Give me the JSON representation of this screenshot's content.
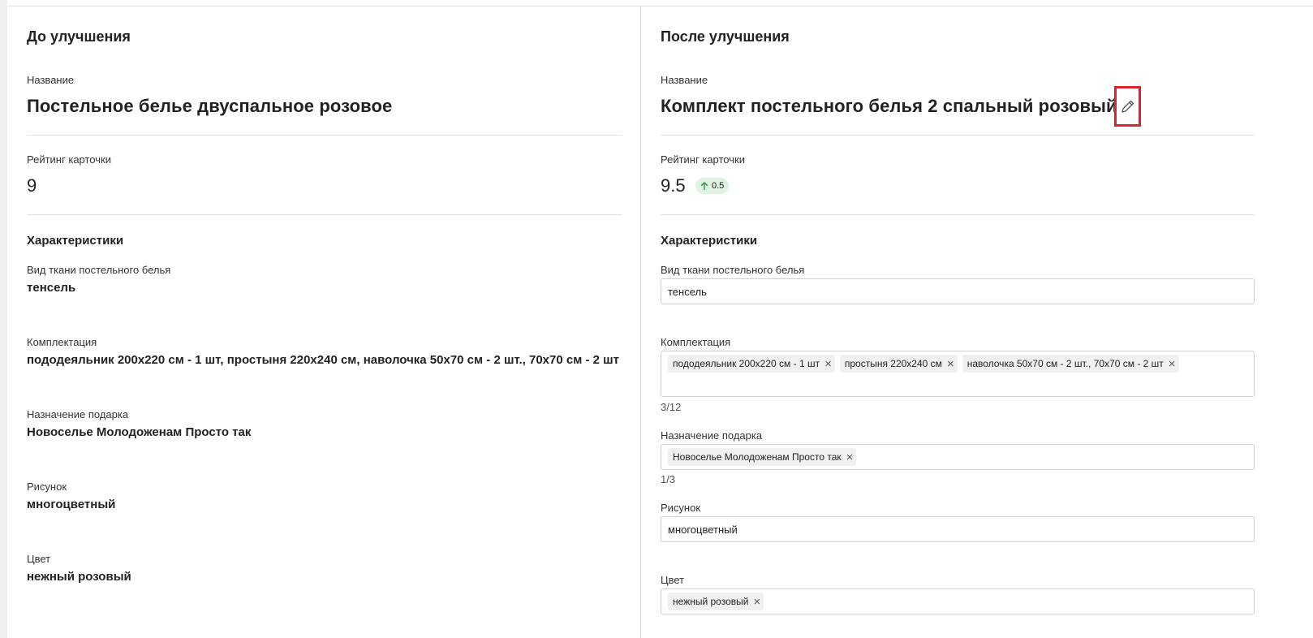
{
  "before": {
    "heading": "До улучшения",
    "name_label": "Название",
    "name_value": "Постельное белье двуспальное розовое",
    "rating_label": "Рейтинг карточки",
    "rating_value": "9",
    "specs_heading": "Характеристики",
    "fabric_label": "Вид ткани постельного белья",
    "fabric_value": "тенсель",
    "kit_label": "Комплектация",
    "kit_value": "пододеяльник 200х220 см - 1 шт, простыня 220х240 см, наволочка 50х70 см - 2 шт., 70х70 см - 2 шт",
    "gift_label": "Назначение подарка",
    "gift_value": "Новоселье Молодоженам Просто так",
    "pattern_label": "Рисунок",
    "pattern_value": "многоцветный",
    "color_label": "Цвет",
    "color_value": "нежный розовый"
  },
  "after": {
    "heading": "После улучшения",
    "name_label": "Название",
    "name_value": "Комплект постельного белья 2 спальный розовый",
    "edit_icon": "pencil-icon",
    "rating_label": "Рейтинг карточки",
    "rating_value": "9.5",
    "rating_delta": "0.5",
    "rating_delta_icon": "arrow-up-icon",
    "specs_heading": "Характеристики",
    "fabric_label": "Вид ткани постельного белья",
    "fabric_value": "тенсель",
    "kit_label": "Комплектация",
    "kit_chips": [
      "пододеяльник 200х220 см - 1 шт",
      "простыня 220х240 см",
      "наволочка 50х70 см - 2 шт., 70х70 см - 2 шт"
    ],
    "kit_counter": "3/12",
    "gift_label": "Назначение подарка",
    "gift_chips": [
      "Новоселье Молодоженам Просто так"
    ],
    "gift_counter": "1/3",
    "pattern_label": "Рисунок",
    "pattern_value": "многоцветный",
    "color_label": "Цвет",
    "color_chips": [
      "нежный розовый"
    ]
  },
  "colors": {
    "highlight_border": "#e0222c",
    "delta_badge_bg": "#dff3e2",
    "delta_arrow": "#2e9a4a"
  }
}
